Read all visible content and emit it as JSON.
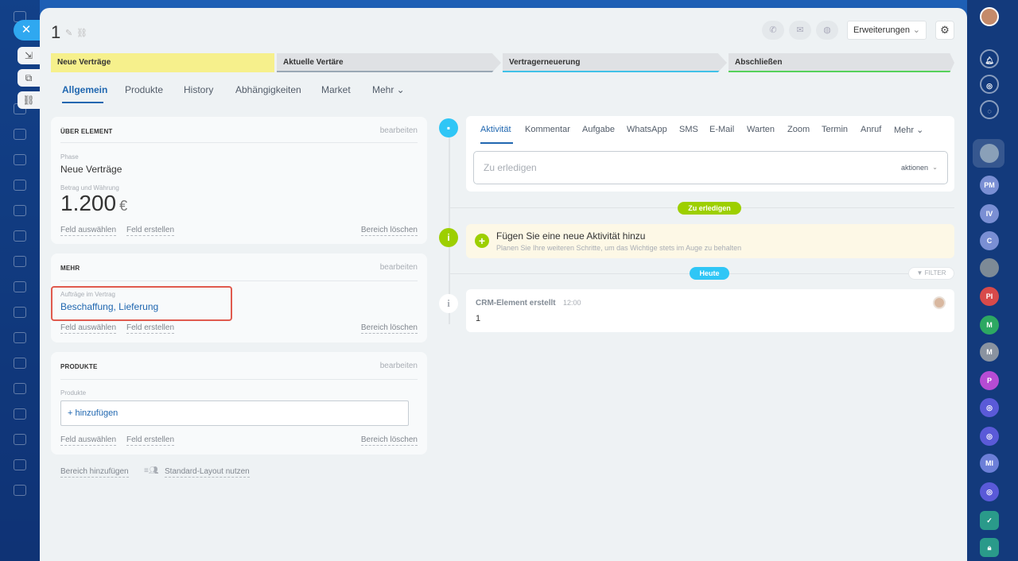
{
  "header": {
    "title": "1",
    "extensions_label": "Erweiterungen"
  },
  "stages": [
    "Neue Verträge",
    "Aktuelle Vertäre",
    "Vertragerneuerung",
    "Abschließen"
  ],
  "tabs": [
    "Allgemein",
    "Produkte",
    "History",
    "Abhängigkeiten",
    "Market",
    "Mehr"
  ],
  "about_card": {
    "title": "ÜBER ELEMENT",
    "edit_label": "bearbeiten",
    "phase_label": "Phase",
    "phase_value": "Neue Verträge",
    "amount_label": "Betrag und Währung",
    "amount_value": "1.200",
    "currency": "€",
    "select_field": "Feld auswählen",
    "create_field": "Feld erstellen",
    "delete_section": "Bereich löschen"
  },
  "more_card": {
    "title": "MEHR",
    "edit_label": "bearbeiten",
    "orders_label": "Aufträge im Vertrag",
    "orders_value": "Beschaffung, Lieferung",
    "select_field": "Feld auswählen",
    "create_field": "Feld erstellen",
    "delete_section": "Bereich löschen"
  },
  "products_card": {
    "title": "PRODUKTE",
    "edit_label": "bearbeiten",
    "products_label": "Produkte",
    "add_label": "+ hinzufügen",
    "select_field": "Feld auswählen",
    "create_field": "Feld erstellen",
    "delete_section": "Bereich löschen"
  },
  "bottom": {
    "add_section": "Bereich hinzufügen",
    "standard_layout": "Standard-Layout nutzen"
  },
  "activity": {
    "tabs": [
      "Aktivität",
      "Kommentar",
      "Aufgabe",
      "WhatsApp",
      "SMS",
      "E-Mail",
      "Warten",
      "Zoom",
      "Termin",
      "Anruf",
      "Mehr"
    ],
    "placeholder": "Zu erledigen",
    "actions_label": "aktionen"
  },
  "timeline": {
    "todo_pill": "Zu erledigen",
    "todo_title": "Fügen Sie eine neue Aktivität hinzu",
    "todo_sub": "Planen Sie Ihre weiteren Schritte, um das Wichtige stets im Auge zu behalten",
    "today_pill": "Heute",
    "filter_label": "FILTER",
    "crm_title": "CRM-Element erstellt",
    "crm_time": "12:00",
    "crm_body": "1"
  },
  "right_rail_avatars": [
    "PM",
    "IV",
    "C",
    "PI",
    "M",
    "M",
    "P",
    "MI"
  ],
  "colors": {
    "accent": "#2067b0",
    "stage_active": "#f6f08c",
    "todo_green": "#9dcf00",
    "today_blue": "#2fc6f6",
    "highlight_red": "#e05a4e"
  }
}
